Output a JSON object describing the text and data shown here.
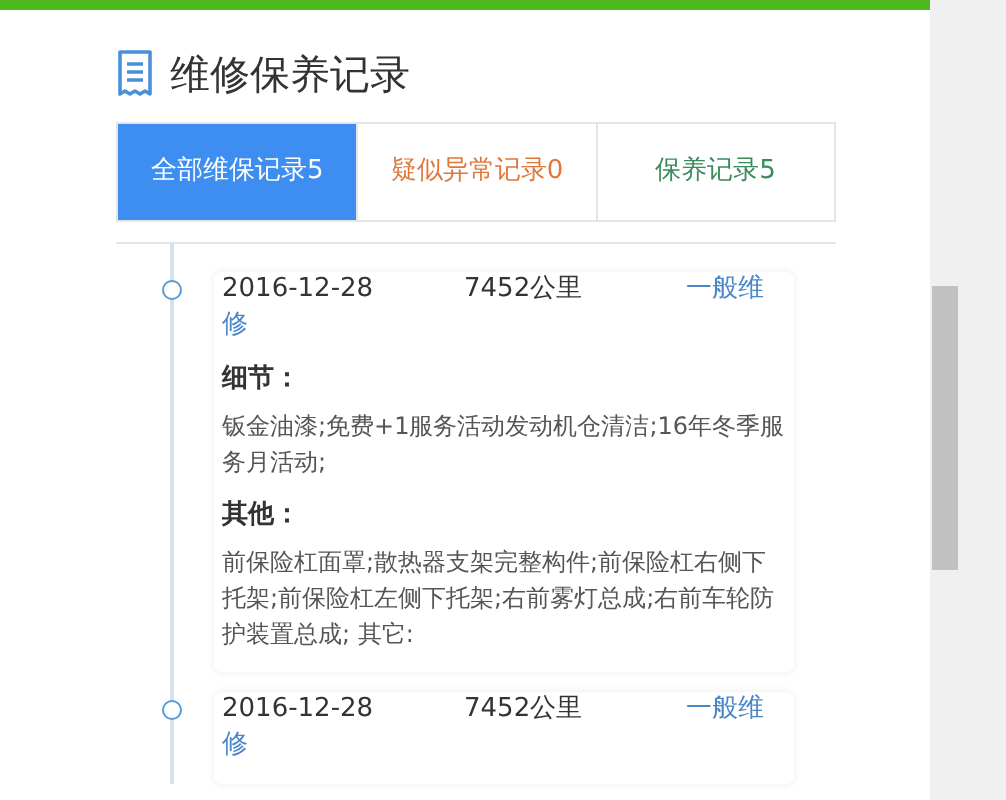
{
  "title": "维修保养记录",
  "tabs": [
    {
      "label": "全部维保记录5",
      "selected": true,
      "color": "#ffffff"
    },
    {
      "label": "疑似异常记录0",
      "selected": false,
      "color": "#e0783c"
    },
    {
      "label": "保养记录5",
      "selected": false,
      "color": "#3a8a5a"
    }
  ],
  "records": [
    {
      "date": "2016-12-28",
      "mileage": "7452公里",
      "type": "一般维修",
      "sections": [
        {
          "heading": "细节：",
          "text": "钣金油漆;免费+1服务活动发动机仓清洁;16年冬季服务月活动;"
        },
        {
          "heading": "其他：",
          "text": "前保险杠面罩;散热器支架完整构件;前保险杠右侧下托架;前保险杠左侧下托架;右前雾灯总成;右前车轮防护装置总成; 其它:"
        }
      ]
    },
    {
      "date": "2016-12-28",
      "mileage": "7452公里",
      "type": "一般维修"
    }
  ]
}
